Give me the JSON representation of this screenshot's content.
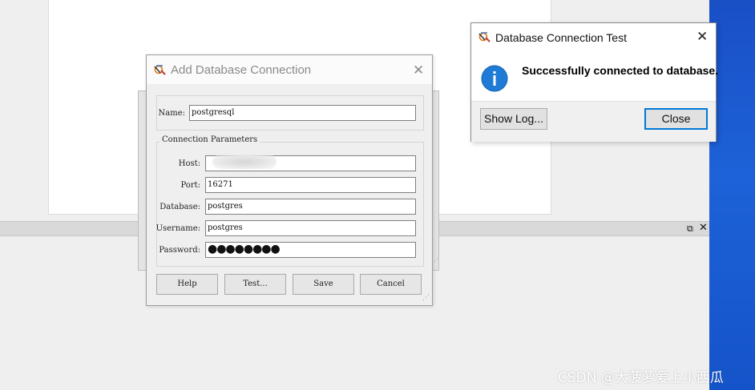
{
  "background": {
    "bar_restore_icon": "restore-icon",
    "bar_close_icon": "close-icon",
    "desktop_color": "#1d62d8"
  },
  "add_dialog": {
    "title": "Add Database Connection",
    "close_glyph": "✕",
    "name_label": "Name:",
    "name_value": "postgresql",
    "group_title": "Connection Parameters",
    "host_label": "Host:",
    "host_value": "",
    "port_label": "Port:",
    "port_value": "16271",
    "database_label": "Database:",
    "database_value": "postgres",
    "username_label": "Username:",
    "username_value": "postgres",
    "password_label": "Password:",
    "password_value": "●●●●●●●●",
    "buttons": {
      "help": "Help",
      "test": "Test...",
      "save": "Save",
      "cancel": "Cancel"
    }
  },
  "test_dialog": {
    "title": "Database Connection Test",
    "close_glyph": "✕",
    "message": "Successfully connected to database.",
    "icon": "info-icon",
    "accent_color": "#0078d7",
    "show_log_label": "Show Log...",
    "close_label": "Close"
  },
  "watermark": "CSDN @大菠萝爱上小西瓜"
}
